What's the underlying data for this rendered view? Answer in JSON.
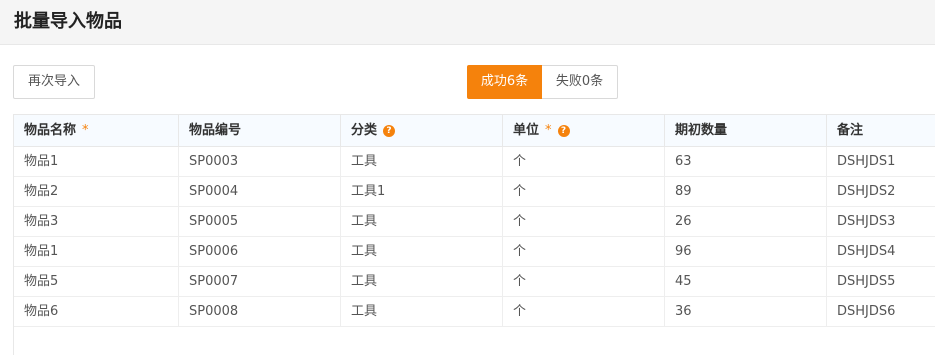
{
  "header": {
    "title": "批量导入物品"
  },
  "toolbar": {
    "reimport_label": "再次导入",
    "success_label": "成功6条",
    "fail_label": "失败0条"
  },
  "colors": {
    "accent": "#f5820c",
    "header_bg": "#f5f5f5",
    "table_head_bg": "#f7fbff"
  },
  "table": {
    "columns": [
      {
        "label": "物品名称",
        "required": "*",
        "help": ""
      },
      {
        "label": "物品编号",
        "required": "",
        "help": ""
      },
      {
        "label": "分类",
        "required": "",
        "help": "?"
      },
      {
        "label": "单位",
        "required": "*",
        "help": "?"
      },
      {
        "label": "期初数量",
        "required": "",
        "help": ""
      },
      {
        "label": "备注",
        "required": "",
        "help": ""
      }
    ],
    "rows": [
      [
        "物品1",
        "SP0003",
        "工具",
        "个",
        "63",
        "DSHJDS1"
      ],
      [
        "物品2",
        "SP0004",
        "工具1",
        "个",
        "89",
        "DSHJDS2"
      ],
      [
        "物品3",
        "SP0005",
        "工具",
        "个",
        "26",
        "DSHJDS3"
      ],
      [
        "物品1",
        "SP0006",
        "工具",
        "个",
        "96",
        "DSHJDS4"
      ],
      [
        "物品5",
        "SP0007",
        "工具",
        "个",
        "45",
        "DSHJDS5"
      ],
      [
        "物品6",
        "SP0008",
        "工具",
        "个",
        "36",
        "DSHJDS6"
      ]
    ]
  }
}
